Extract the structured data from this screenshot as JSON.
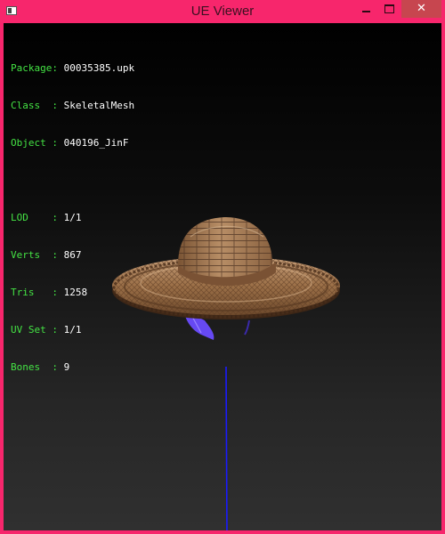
{
  "window": {
    "title": "UE Viewer",
    "minimize_icon": "minimize-icon",
    "maximize_icon": "maximize-icon",
    "close_icon": "close-icon",
    "close_glyph": "✕"
  },
  "info": {
    "package": {
      "label": "Package:",
      "value": "00035385.upk"
    },
    "class": {
      "label": "Class  :",
      "value": "SkeletalMesh"
    },
    "object": {
      "label": "Object :",
      "value": "040196_JinF"
    },
    "lod": {
      "label": "LOD    :",
      "value": "1/1"
    },
    "verts": {
      "label": "Verts  :",
      "value": "867"
    },
    "tris": {
      "label": "Tris   :",
      "value": "1258"
    },
    "uvset": {
      "label": "UV Set :",
      "value": "1/1"
    },
    "bones": {
      "label": "Bones  :",
      "value": "9"
    }
  },
  "colors": {
    "frame": "#f7266c",
    "close_button": "#c7464f",
    "label_green": "#44e344",
    "value_white": "#ffffff",
    "bone_line": "#1a1aff",
    "ribbon": "#6a4cff"
  }
}
